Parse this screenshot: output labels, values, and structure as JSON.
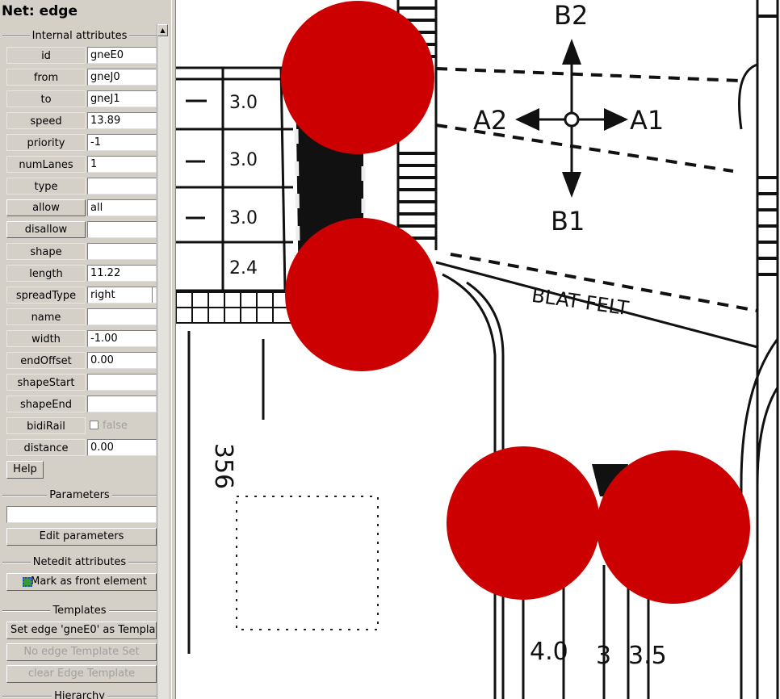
{
  "panel": {
    "title": "Net: edge",
    "internal_attributes_title": "Internal attributes",
    "attributes": [
      {
        "name": "id",
        "value": "gneE0",
        "button": false
      },
      {
        "name": "from",
        "value": "gneJ0",
        "button": false
      },
      {
        "name": "to",
        "value": "gneJ1",
        "button": false
      },
      {
        "name": "speed",
        "value": "13.89",
        "button": false
      },
      {
        "name": "priority",
        "value": "-1",
        "button": false
      },
      {
        "name": "numLanes",
        "value": "1",
        "button": false
      },
      {
        "name": "type",
        "value": "",
        "button": false
      },
      {
        "name": "allow",
        "value": "all",
        "button": true
      },
      {
        "name": "disallow",
        "value": "",
        "button": true
      },
      {
        "name": "shape",
        "value": "",
        "button": false
      },
      {
        "name": "length",
        "value": "11.22",
        "button": false
      },
      {
        "name": "spreadType",
        "value": "right",
        "button": false
      },
      {
        "name": "name",
        "value": "",
        "button": false
      },
      {
        "name": "width",
        "value": "-1.00",
        "button": false
      },
      {
        "name": "endOffset",
        "value": "0.00",
        "button": false
      },
      {
        "name": "shapeStart",
        "value": "",
        "button": false
      },
      {
        "name": "shapeEnd",
        "value": "",
        "button": false
      },
      {
        "name": "bidiRail",
        "value": "false",
        "button": false
      },
      {
        "name": "distance",
        "value": "0.00",
        "button": false
      }
    ],
    "help_label": "Help",
    "parameters_title": "Parameters",
    "parameters_value": "",
    "edit_parameters_label": "Edit parameters",
    "netedit_attributes_title": "Netedit attributes",
    "mark_front_label": "Mark as front element",
    "templates_title": "Templates",
    "set_template_label": "Set edge 'gneE0' as Templat",
    "no_template_label": "No edge Template Set",
    "clear_template_label": "clear Edge Template",
    "hierarchy_title": "Hierarchy"
  },
  "map": {
    "labels": {
      "b2": "B2",
      "b1": "B1",
      "a1": "A1",
      "a2": "A2",
      "lane1": "3.0",
      "lane2": "3.0",
      "lane3": "3.0",
      "lane4": "2.4",
      "road": "BLAT FELT",
      "num356": "356",
      "d40": "4.0",
      "d3": "3",
      "d35": "3.5"
    }
  },
  "colors": {
    "junction": "#cc0000",
    "panel_bg": "#d4d0c8"
  }
}
